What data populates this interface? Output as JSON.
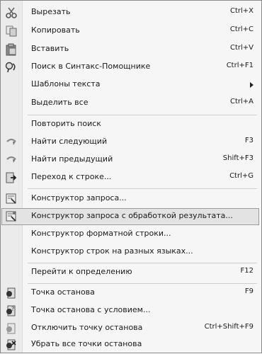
{
  "menu": {
    "items": [
      {
        "label": "Вырезать",
        "shortcut": "Ctrl+X",
        "icon": "scissors-icon"
      },
      {
        "label": "Копировать",
        "shortcut": "Ctrl+C",
        "icon": "copy-icon"
      },
      {
        "label": "Вставить",
        "shortcut": "Ctrl+V",
        "icon": "paste-icon"
      },
      {
        "label": "Поиск в Синтакс-Помощнике",
        "shortcut": "Ctrl+F1",
        "icon": "syntax-helper-search-icon"
      },
      {
        "label": "Шаблоны текста",
        "shortcut": "",
        "icon": ""
      },
      {
        "label": "Выделить все",
        "shortcut": "Ctrl+A",
        "icon": ""
      },
      {
        "label": "Повторить поиск",
        "shortcut": "",
        "icon": ""
      },
      {
        "label": "Найти следующий",
        "shortcut": "F3",
        "icon": "find-next-icon"
      },
      {
        "label": "Найти предыдущий",
        "shortcut": "Shift+F3",
        "icon": "find-previous-icon"
      },
      {
        "label": "Переход к строке...",
        "shortcut": "Ctrl+G",
        "icon": "goto-line-icon"
      },
      {
        "label": "Конструктор запроса...",
        "shortcut": "",
        "icon": "query-builder-icon"
      },
      {
        "label": "Конструктор запроса с обработкой результата...",
        "shortcut": "",
        "icon": "query-builder-result-icon"
      },
      {
        "label": "Конструктор форматной строки...",
        "shortcut": "",
        "icon": ""
      },
      {
        "label": "Конструктор строк на разных языках...",
        "shortcut": "",
        "icon": ""
      },
      {
        "label": "Перейти к определению",
        "shortcut": "F12",
        "icon": ""
      },
      {
        "label": "Точка останова",
        "shortcut": "F9",
        "icon": "breakpoint-icon"
      },
      {
        "label": "Точка останова с условием...",
        "shortcut": "",
        "icon": "conditional-breakpoint-icon"
      },
      {
        "label": "Отключить точку останова",
        "shortcut": "Ctrl+Shift+F9",
        "icon": "disable-breakpoint-icon"
      },
      {
        "label": "Убрать все точки останова",
        "shortcut": "",
        "icon": "remove-all-breakpoints-icon"
      }
    ]
  }
}
